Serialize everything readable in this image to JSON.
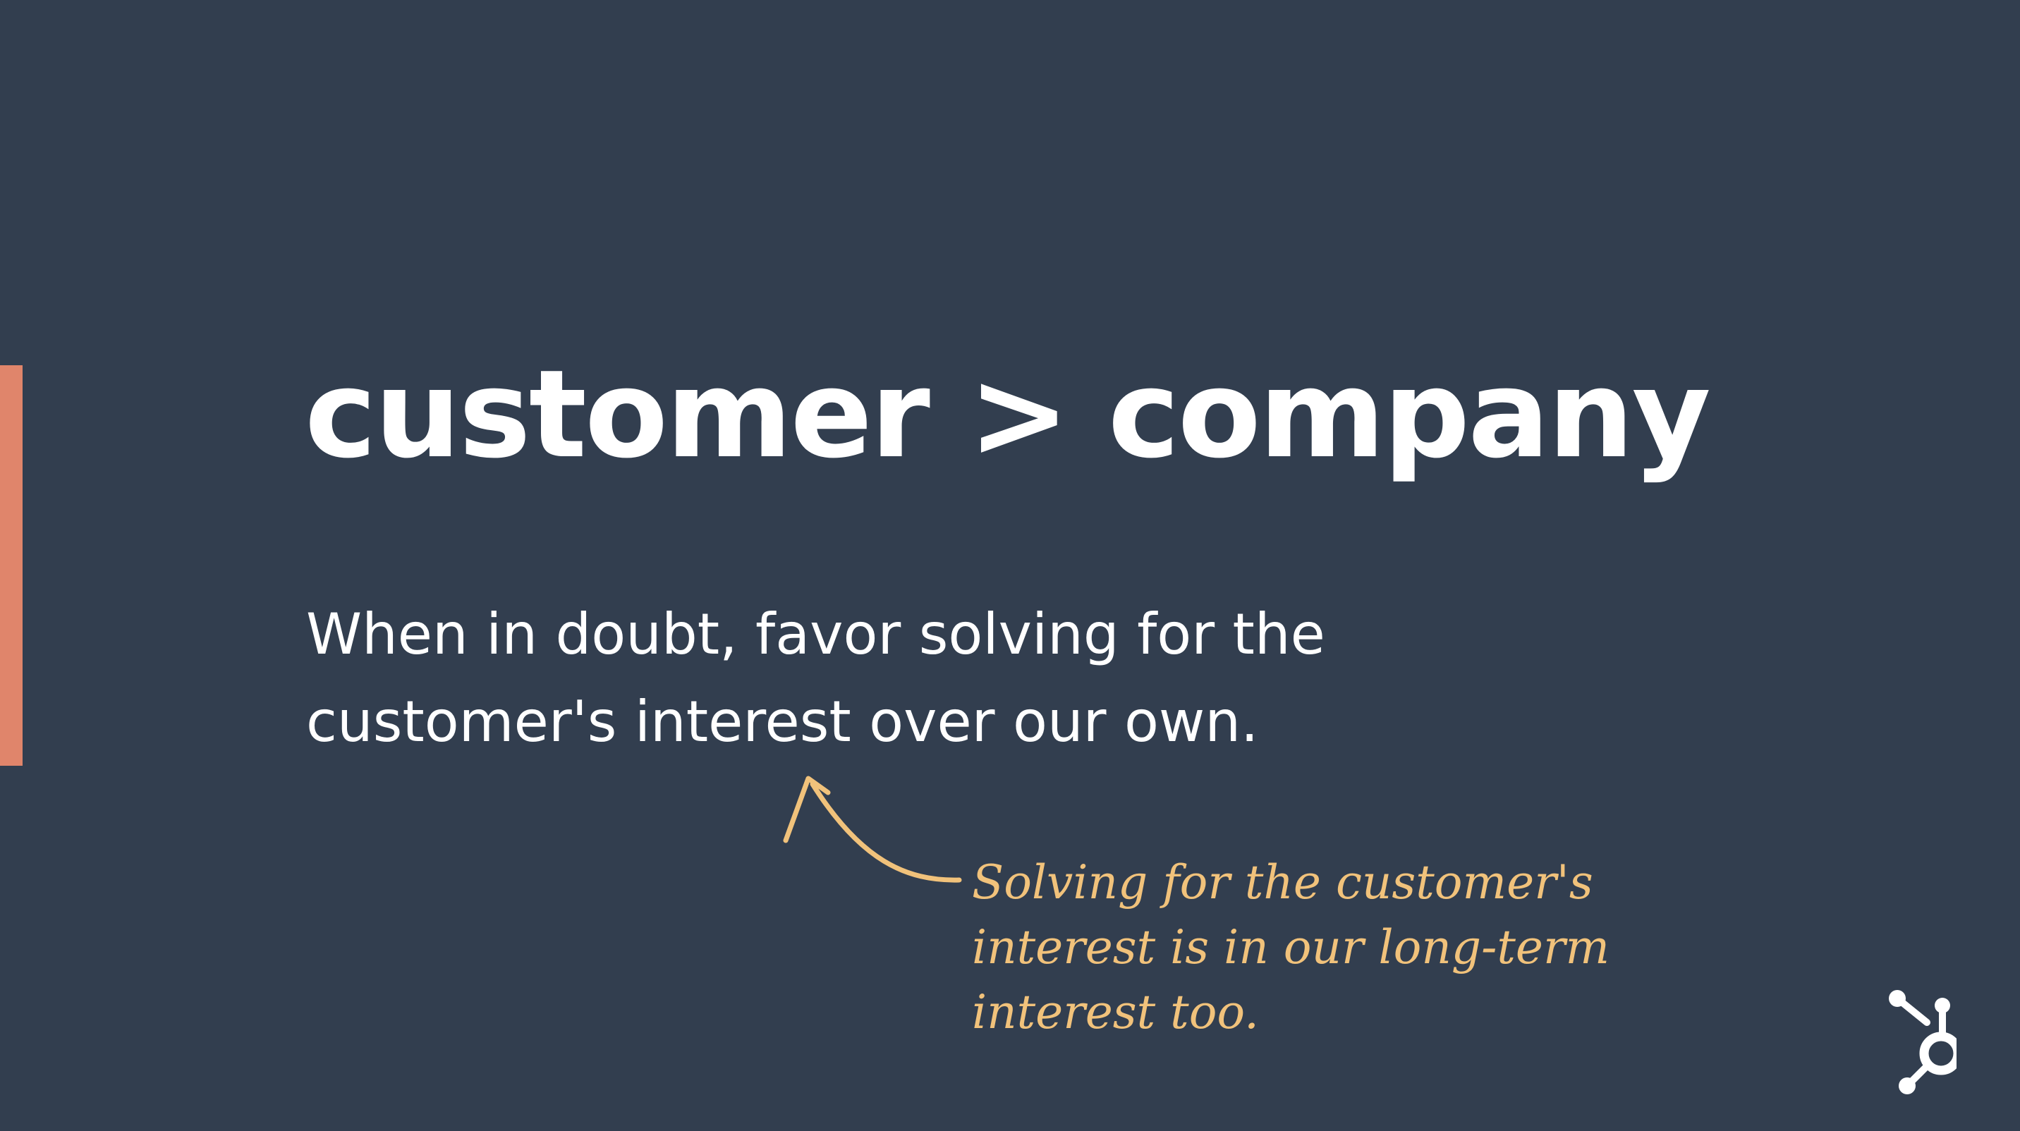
{
  "slide": {
    "title": "customer > company",
    "body_lines": [
      "When in doubt, favor solving for the",
      "customer's interest over our own."
    ],
    "annotation_lines": [
      "Solving for the customer's",
      "interest is in our long-term",
      "interest too."
    ]
  },
  "icons": {
    "annotation_arrow": "curved-arrow-icon",
    "brand_logo": "hubspot-sprocket-icon"
  },
  "colors": {
    "background": "#323e4f",
    "accent": "#e0856b",
    "annotation": "#f1c27b",
    "text": "#ffffff"
  }
}
